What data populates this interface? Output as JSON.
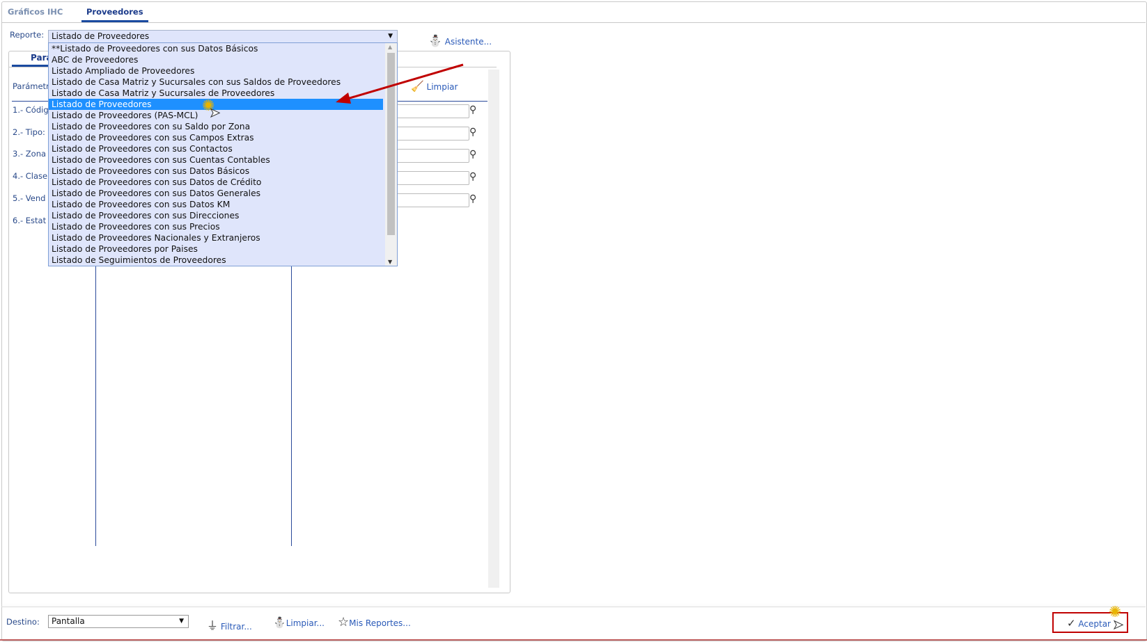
{
  "tabs": [
    "Gráficos IHC",
    "Proveedores"
  ],
  "reporte": {
    "label": "Reporte:",
    "value": "Listado de Proveedores",
    "options": [
      "**Listado de Proveedores con sus Datos Básicos",
      "ABC de Proveedores",
      "Listado Ampliado de Proveedores",
      "Listado de Casa Matriz y Sucursales con sus Saldos de Proveedores",
      "Listado de Casa Matriz y Sucursales de Proveedores",
      "Listado de Proveedores",
      "Listado de Proveedores (PAS-MCL)",
      "Listado de Proveedores con su Saldo por Zona",
      "Listado de Proveedores con sus Campos Extras",
      "Listado de Proveedores con sus Contactos",
      "Listado de Proveedores con sus Cuentas Contables",
      "Listado de Proveedores con sus Datos Básicos",
      "Listado de Proveedores con sus Datos de Crédito",
      "Listado de Proveedores con sus Datos Generales",
      "Listado de Proveedores con sus Datos KM",
      "Listado de Proveedores con sus Direcciones",
      "Listado de Proveedores con sus Precios",
      "Listado de Proveedores Nacionales y Extranjeros",
      "Listado de Proveedores por Paises",
      "Listado de Seguimientos de Proveedores"
    ],
    "selected_index": 5
  },
  "asistente": "Asistente...",
  "panel": {
    "tab": "Pará",
    "params_header": "Parámetr",
    "limpiar": "Limpiar",
    "params": [
      "1.- Códig",
      "2.- Tipo:",
      "3.- Zona",
      "4.- Clase",
      "5.- Vend",
      "6.- Estat"
    ]
  },
  "footer": {
    "destino_label": "Destino:",
    "destino_value": "Pantalla",
    "filtrar": "Filtrar...",
    "limpiar": "Limpiar...",
    "mis_reportes": "Mis Reportes...",
    "aceptar": "Aceptar"
  },
  "colors": {
    "accent": "#1e90ff",
    "annotation": "#c00000"
  }
}
